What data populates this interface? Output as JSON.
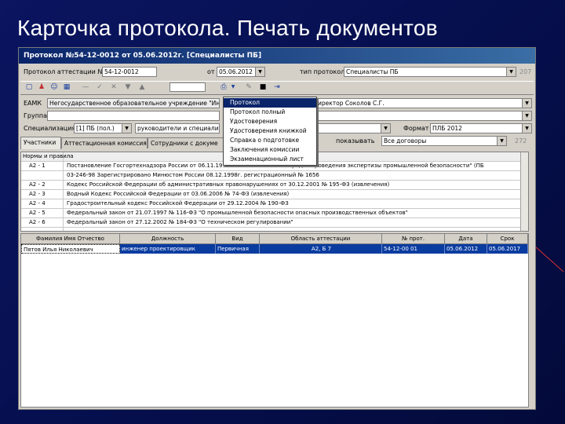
{
  "slide_title": "Карточка протокола. Печать документов",
  "window": {
    "title": "Протокол №54-12-0012 от 05.06.2012г. [Специалисты ПБ]"
  },
  "header_row": {
    "protocol_label": "Протокол аттестации №",
    "protocol_number": "54-12-0012",
    "date_label": "от",
    "date_value": "05.06.2012",
    "type_label": "тип протокола",
    "type_value": "Специалисты ПБ",
    "extra_value": "207"
  },
  "toolbar": {
    "zoom_value": "",
    "icons": [
      "new-icon",
      "user-icon",
      "users-icon",
      "calculator-icon",
      "delete-icon",
      "check-icon",
      "cancel-icon",
      "arrow-down-icon",
      "arrow-up-icon",
      "print-icon",
      "chevron-down-icon",
      "settings-icon",
      "save-icon",
      "exit-icon"
    ]
  },
  "fields": {
    "eamk_label": "ЕАМК",
    "eamk_value": "Негосударственное образовательное учреждение \"Инж",
    "eamk_right": "иректор Соколов С.Г.",
    "group_label": "Группа",
    "group_value": "",
    "spec_label": "Специализация",
    "spec_value1": "[1] ПБ (пол.)",
    "spec_value2": "руководители и специалисты",
    "spec_value3": "",
    "spec_field_right": "",
    "format_label": "Формат",
    "format_value": "ПЛБ 2012",
    "pokazovat_label": "показывать",
    "pokazovat_value": "Все договоры",
    "pokazovat_extra": "272"
  },
  "tabs": [
    {
      "label": "Участники"
    },
    {
      "label": "Аттестационная комиссия"
    },
    {
      "label": "Сотрудники с докуме"
    }
  ],
  "norms_grid": {
    "title": "Нормы и правила",
    "rows": [
      {
        "code": "А2 - 1",
        "text": "Постановление Госгортехнадзора России от 06.11.1998 № ... положения о порядке проведения экспертизы промышленной безопасности\" (ПБ"
      },
      {
        "code": "",
        "text": "03-246-98 Зарегистрировано Минюстом России 08.12.1998г. регистрационный № 1656"
      },
      {
        "code": "А2 - 2",
        "text": "Кодекс Российской Федерации об административных правонарушениях от 30.12.2001 № 195-ФЗ (извлечения)"
      },
      {
        "code": "А2 - 3",
        "text": "Водный Кодекс Российской Федерации от 03.06.2006 № 74-ФЗ (извлечения)"
      },
      {
        "code": "А2 - 4",
        "text": "Градостроительный кодекс Российской Федерации от 29.12.2004 № 190-ФЗ"
      },
      {
        "code": "А2 - 5",
        "text": "Федеральный закон от 21.07.1997 № 116-ФЗ \"О промышленной безопасности опасных производственных объектов\""
      },
      {
        "code": "А2 - 6",
        "text": "Федеральный закон от 27.12.2002 № 184-ФЗ \"О техническом регулировании\""
      }
    ]
  },
  "participants_grid": {
    "columns": [
      "Фамилия Имя Отчество",
      "Должность",
      "Вид",
      "Область аттестации",
      "№ прот.",
      "Дата",
      "Срок"
    ],
    "rows": [
      {
        "fio": "Пятов Илья Николаевич",
        "position": "инженер проектировщик",
        "kind": "Первичная",
        "area": "А2, Б 7",
        "num": "54-12-00 01",
        "date": "05.06.2012",
        "term": "05.06.2017"
      }
    ]
  },
  "print_menu": {
    "items": [
      "Протокол",
      "Протокол полный",
      "Удостоверения",
      "Удостоверения книжкой",
      "Справка о подготовке",
      "Заключения комиссии",
      "Экзаменационный лист"
    ],
    "selected_index": 0
  },
  "colors": {
    "slide_bg": "#061050",
    "titlebar_start": "#0a246a",
    "titlebar_end": "#3a6ea5",
    "selection": "#0a3ca0",
    "window_bg": "#d4d0c8"
  }
}
